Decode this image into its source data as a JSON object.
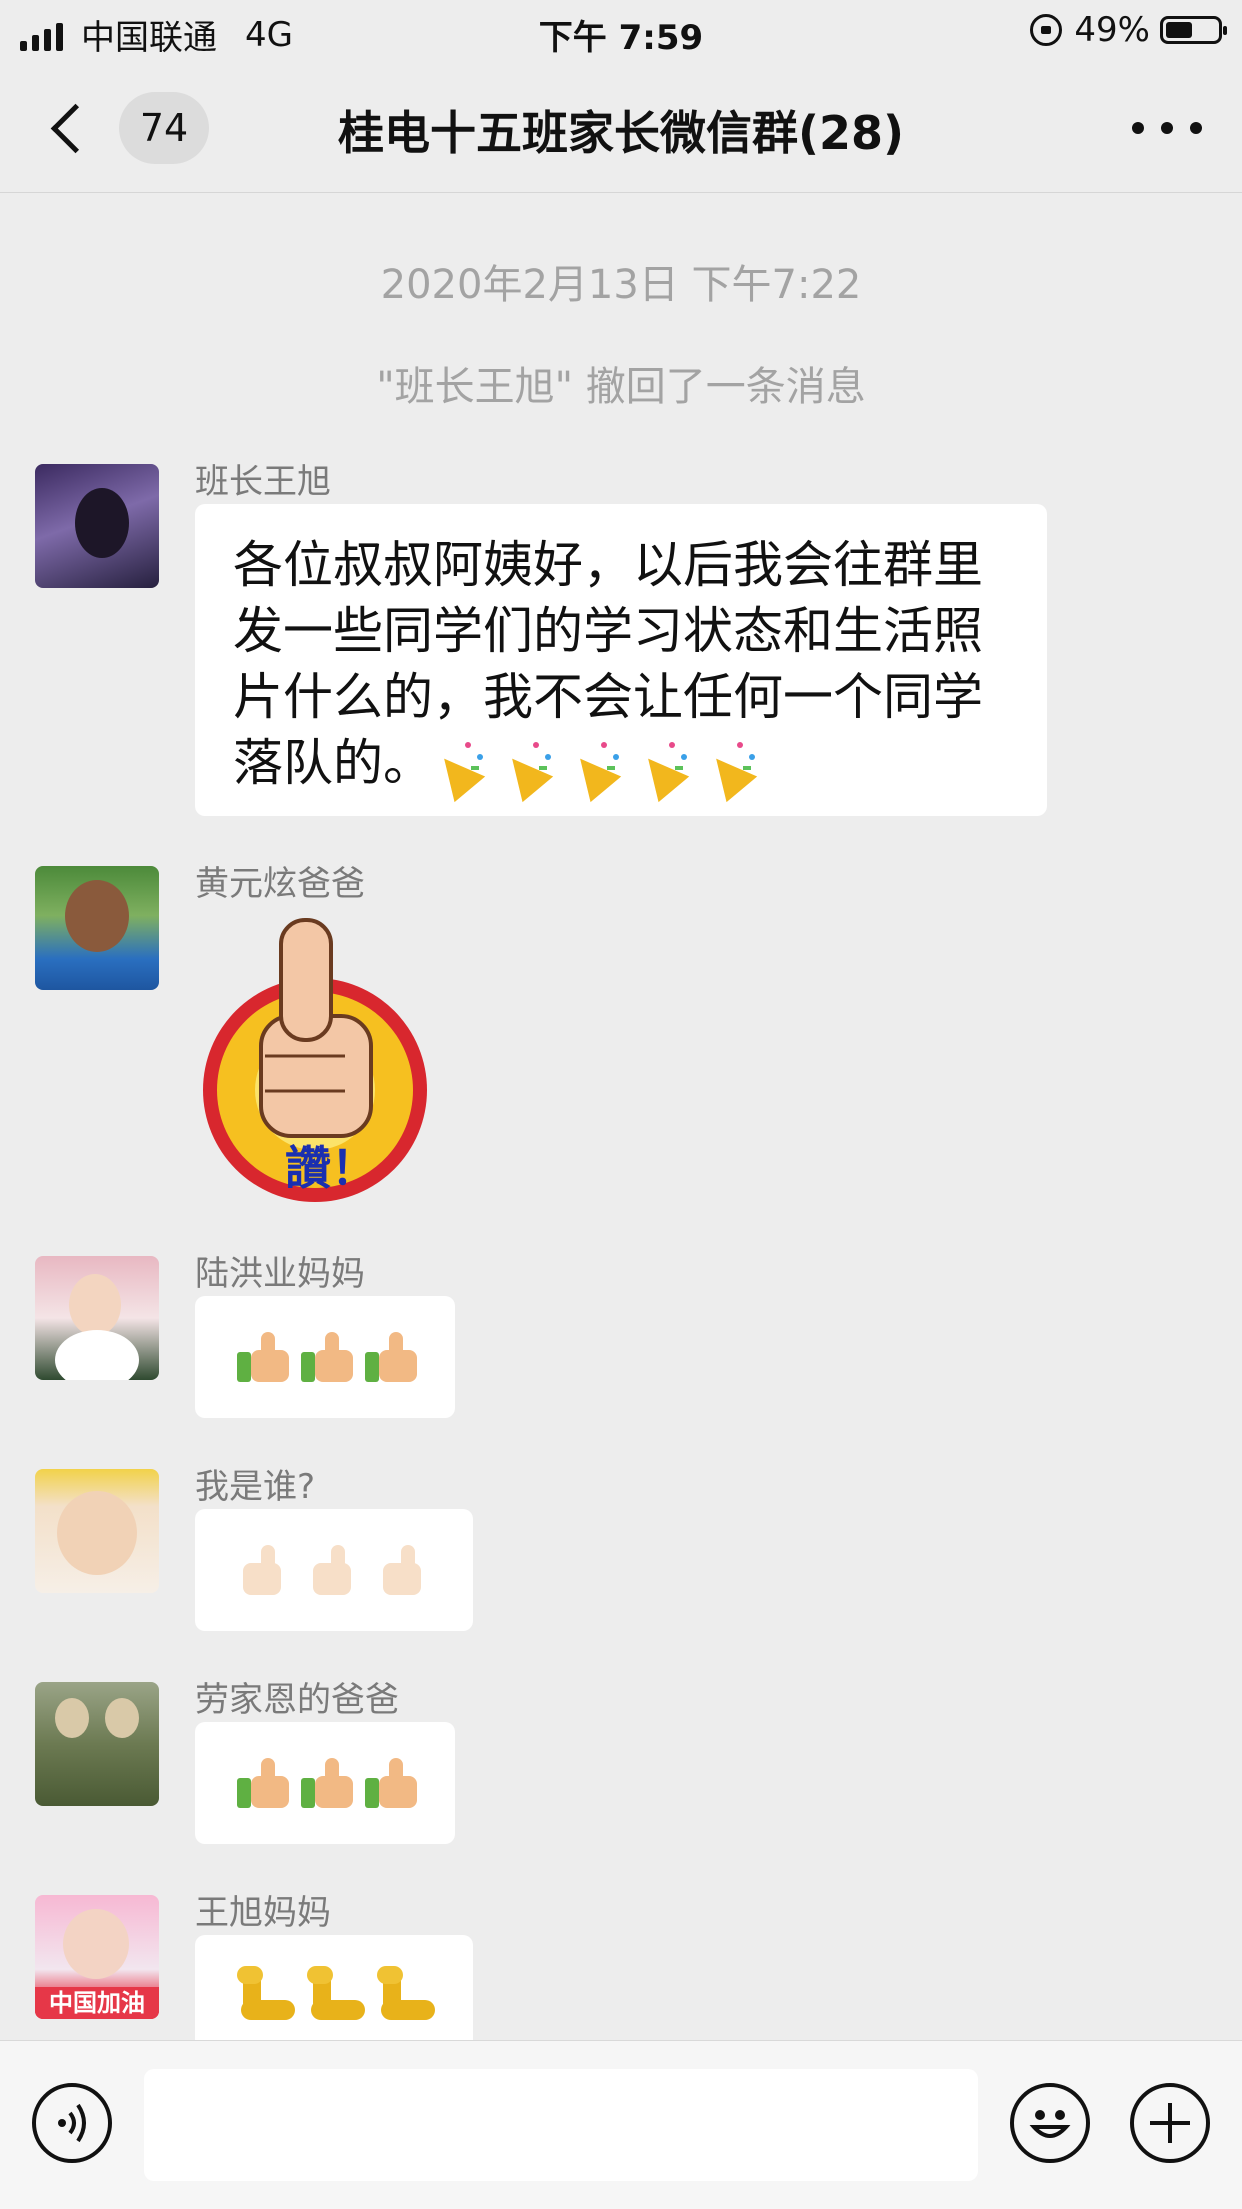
{
  "status_bar": {
    "carrier": "中国联通",
    "network": "4G",
    "time": "下午 7:59",
    "battery": "49%"
  },
  "nav": {
    "unread_badge": "74",
    "title": "桂电十五班家长微信群(28)"
  },
  "chat": {
    "timestamp": "2020年2月13日 下午7:22",
    "recall_notice": "\"班长王旭\" 撤回了一条消息",
    "messages": [
      {
        "sender": "班长王旭",
        "text": "各位叔叔阿姨好，以后我会往群里发一些同学们的学习状态和生活照片什么的，我不会让任何一个同学落队的。",
        "trailing_emoji": "party-popper x5"
      },
      {
        "sender": "黄元炫爸爸",
        "sticker": "thumbs-up sticker",
        "sticker_text": "讚！"
      },
      {
        "sender": "陆洪业妈妈",
        "emoji": "thumbs-up x3"
      },
      {
        "sender": "我是谁?",
        "emoji": "thumbs-up (light) x3"
      },
      {
        "sender": "劳家恩的爸爸",
        "emoji": "thumbs-up x3"
      },
      {
        "sender": "王旭妈妈",
        "emoji": "flexed-biceps x3",
        "avatar_tag": "中国加油"
      }
    ]
  },
  "input": {
    "placeholder": ""
  },
  "colors": {
    "background": "#ededed",
    "bubble": "#ffffff",
    "meta_text": "#a3a3a3"
  }
}
